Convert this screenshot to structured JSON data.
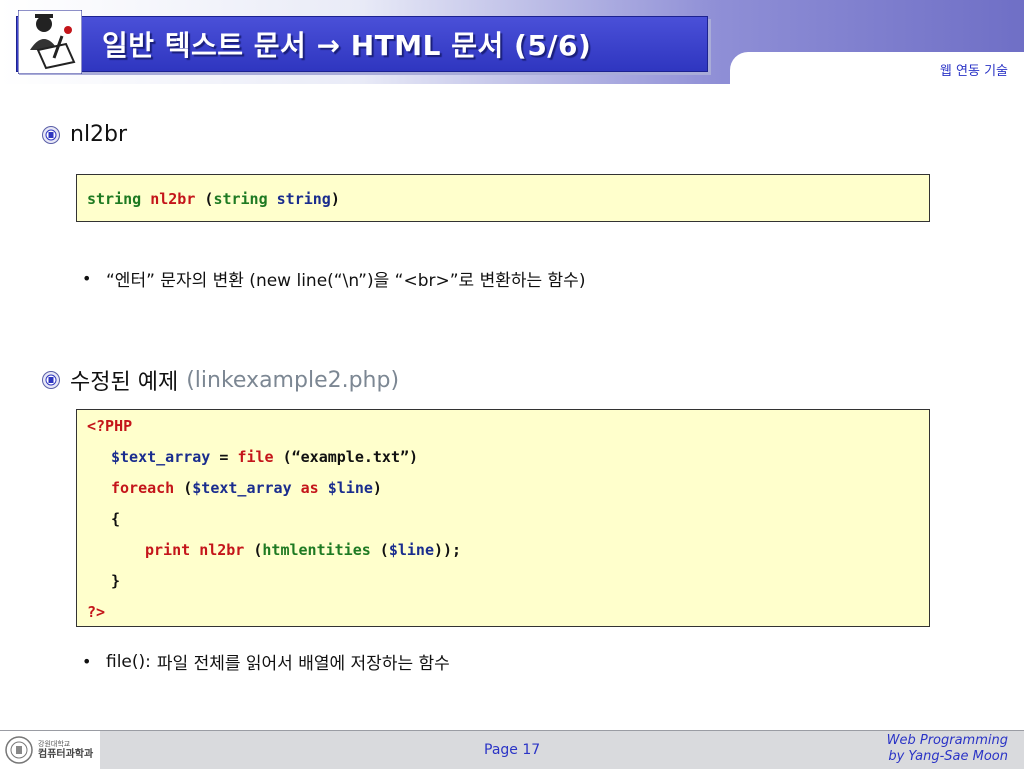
{
  "header": {
    "title": "일반 텍스트 문서 → HTML 문서 (5/6)",
    "course_label": "웹 연동 기술"
  },
  "section1": {
    "heading": "nl2br",
    "code": {
      "t1": "string",
      "t2": "nl2br",
      "t3": "(",
      "t4": "string",
      "t5": "string",
      "t6": ")"
    },
    "bullet": "“엔터” 문자의 변환 (new line(“\\n”)을 “<br>”로 변환하는 함수)"
  },
  "section2": {
    "heading": "수정된 예제",
    "heading_sub": "(linkexample2.php)",
    "code": {
      "l1": "<?PHP",
      "l2a": "$text_array",
      "l2b": " = ",
      "l2c": "file",
      "l2d": " (“example.txt”)",
      "l3a": "foreach",
      "l3b": " (",
      "l3c": "$text_array",
      "l3d": " as ",
      "l3e": "$line",
      "l3f": ")",
      "l4": "{",
      "l5a": "print",
      "l5b": " ",
      "l5c": "nl2br",
      "l5d": " (",
      "l5e": "htmlentities",
      "l5f": " (",
      "l5g": "$line",
      "l5h": "));",
      "l6": "}",
      "l7": "?>"
    },
    "bullet_a": "file():",
    "bullet_b": "파일 전체를 읽어서 배열에 저장하는 함수"
  },
  "footer": {
    "university_top": "강원대학교",
    "university_dept": "컴퓨터과학과",
    "page": "Page 17",
    "credit1": "Web Programming",
    "credit2": "by Yang-Sae Moon"
  },
  "colors": {
    "title_box": "#2f36c0",
    "code_bg": "#ffffcc",
    "keyword_red": "#c4151a",
    "keyword_blue": "#1a2d8e",
    "accent_blue": "#2b34c6"
  },
  "icons": {
    "logo": "professor-at-desk-icon",
    "bullet_section": "university-seal-icon"
  }
}
